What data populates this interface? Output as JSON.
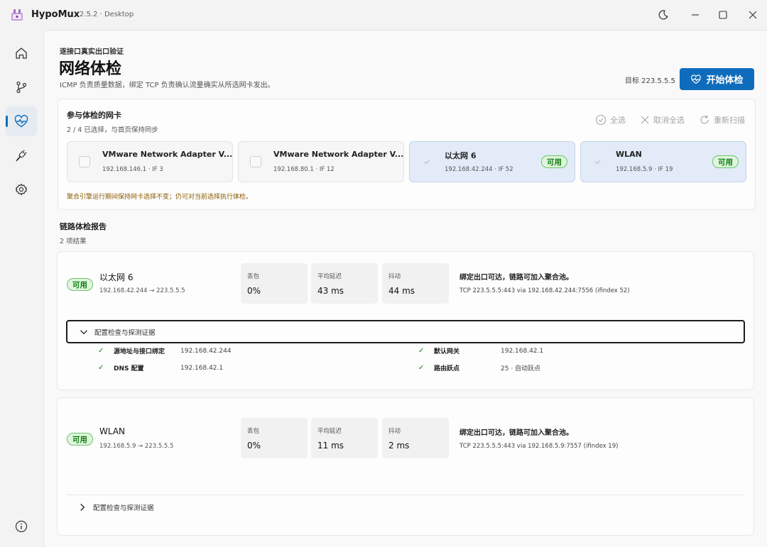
{
  "app": {
    "name": "HypoMux",
    "version": "2.5.2 · Desktop"
  },
  "window_controls": [
    "theme-toggle",
    "minimize",
    "maximize",
    "close"
  ],
  "sidebar": {
    "items": [
      {
        "name": "home",
        "icon": "home-icon",
        "active": false
      },
      {
        "name": "routing",
        "icon": "branch-icon",
        "active": false
      },
      {
        "name": "health-check",
        "icon": "heart-pulse-icon",
        "active": true
      },
      {
        "name": "connections",
        "icon": "plug-icon",
        "active": false
      },
      {
        "name": "settings",
        "icon": "gear-icon",
        "active": false
      },
      {
        "name": "about",
        "icon": "info-icon",
        "active": false
      }
    ]
  },
  "header": {
    "eyebrow": "逐接口真实出口验证",
    "title": "网络体检",
    "description": "ICMP 负责质量数据，绑定 TCP 负责确认流量确实从所选网卡发出。",
    "target": "目标 223.5.5.5",
    "start_button": "开始体检"
  },
  "adapters_card": {
    "title": "参与体检的网卡",
    "subtitle": "2 / 4 已选择，与首页保持同步",
    "actions": {
      "select_all": "全选",
      "deselect_all": "取消全选",
      "rescan": "重新扫描"
    },
    "adapters": [
      {
        "name": "VMware Network Adapter V...",
        "meta": "192.168.146.1 · IF 3",
        "selected": false,
        "badge": ""
      },
      {
        "name": "VMware Network Adapter V...",
        "meta": "192.168.80.1 · IF 12",
        "selected": false,
        "badge": ""
      },
      {
        "name": "以太网 6",
        "meta": "192.168.42.244 · IF 52",
        "selected": true,
        "badge": "可用"
      },
      {
        "name": "WLAN",
        "meta": "192.168.5.9 · IF 19",
        "selected": true,
        "badge": "可用"
      }
    ],
    "note": "聚合引擎运行期间保持网卡选择不变；仍可对当前选择执行体检。"
  },
  "report": {
    "title": "链路体检报告",
    "count": "2 项结果",
    "results": [
      {
        "badge": "可用",
        "name": "以太网 6",
        "route": "192.168.42.244 → 223.5.5.5",
        "metrics": [
          {
            "label": "丢包",
            "value": "0%"
          },
          {
            "label": "平均延迟",
            "value": "43 ms"
          },
          {
            "label": "抖动",
            "value": "44 ms"
          }
        ],
        "verdict": "绑定出口可达，链路可加入聚合池。",
        "detail": "TCP 223.5.5.5:443 via 192.168.42.244:7556 (ifindex 52)",
        "expander": "配置检查与探测证据",
        "expanded": true,
        "checks": [
          {
            "label": "源地址与接口绑定",
            "value": "192.168.42.244"
          },
          {
            "label": "默认网关",
            "value": "192.168.42.1"
          },
          {
            "label": "DNS 配置",
            "value": "192.168.42.1"
          },
          {
            "label": "路由跃点",
            "value": "25 · 自动跃点"
          }
        ]
      },
      {
        "badge": "可用",
        "name": "WLAN",
        "route": "192.168.5.9 → 223.5.5.5",
        "metrics": [
          {
            "label": "丢包",
            "value": "0%"
          },
          {
            "label": "平均延迟",
            "value": "11 ms"
          },
          {
            "label": "抖动",
            "value": "2 ms"
          }
        ],
        "verdict": "绑定出口可达，链路可加入聚合池。",
        "detail": "TCP 223.5.5.5:443 via 192.168.5.9:7557 (ifindex 19)",
        "expander": "配置检查与探测证据",
        "expanded": false
      }
    ]
  },
  "colors": {
    "accent": "#0f6cbd",
    "ok": "#107c10",
    "ok_bg": "#dff6dd",
    "warning_text": "#8a5a00"
  }
}
